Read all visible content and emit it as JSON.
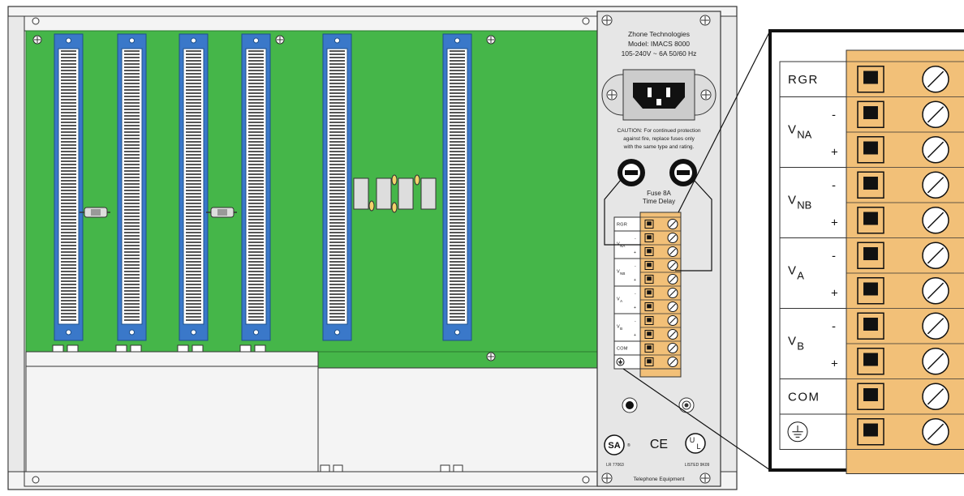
{
  "panel": {
    "manufacturer": "Zhone Technologies",
    "model": "Model: IMACS 8000",
    "power_rating": "105-240V ~ 6A 50/60 Hz",
    "caution_lines": [
      "CAUTION: For continued protection",
      "against fire, replace fuses only",
      "with the same type and rating."
    ],
    "fuse_line1": "Fuse 8A",
    "fuse_line2": "Time Delay",
    "csa_cert": "LR 77063",
    "ul_listing": "LISTED 9K09",
    "footer": "Telephone Equipment",
    "ce_mark": "CE",
    "csa_logo": "SA",
    "ul_logo_u": "U",
    "ul_logo_l": "L",
    "registered": "®"
  },
  "terminal_labels": {
    "rgr": "RGR",
    "v": "V",
    "na": "NA",
    "nb": "NB",
    "a": "A",
    "b": "B",
    "com": "COM",
    "minus": "-",
    "plus": "+"
  },
  "colors": {
    "backplane": "#45b649",
    "connector": "#3a78c9",
    "terminal_block": "#f2c078",
    "chassis": "#f4f4f4",
    "panel": "#e6e6e6"
  }
}
